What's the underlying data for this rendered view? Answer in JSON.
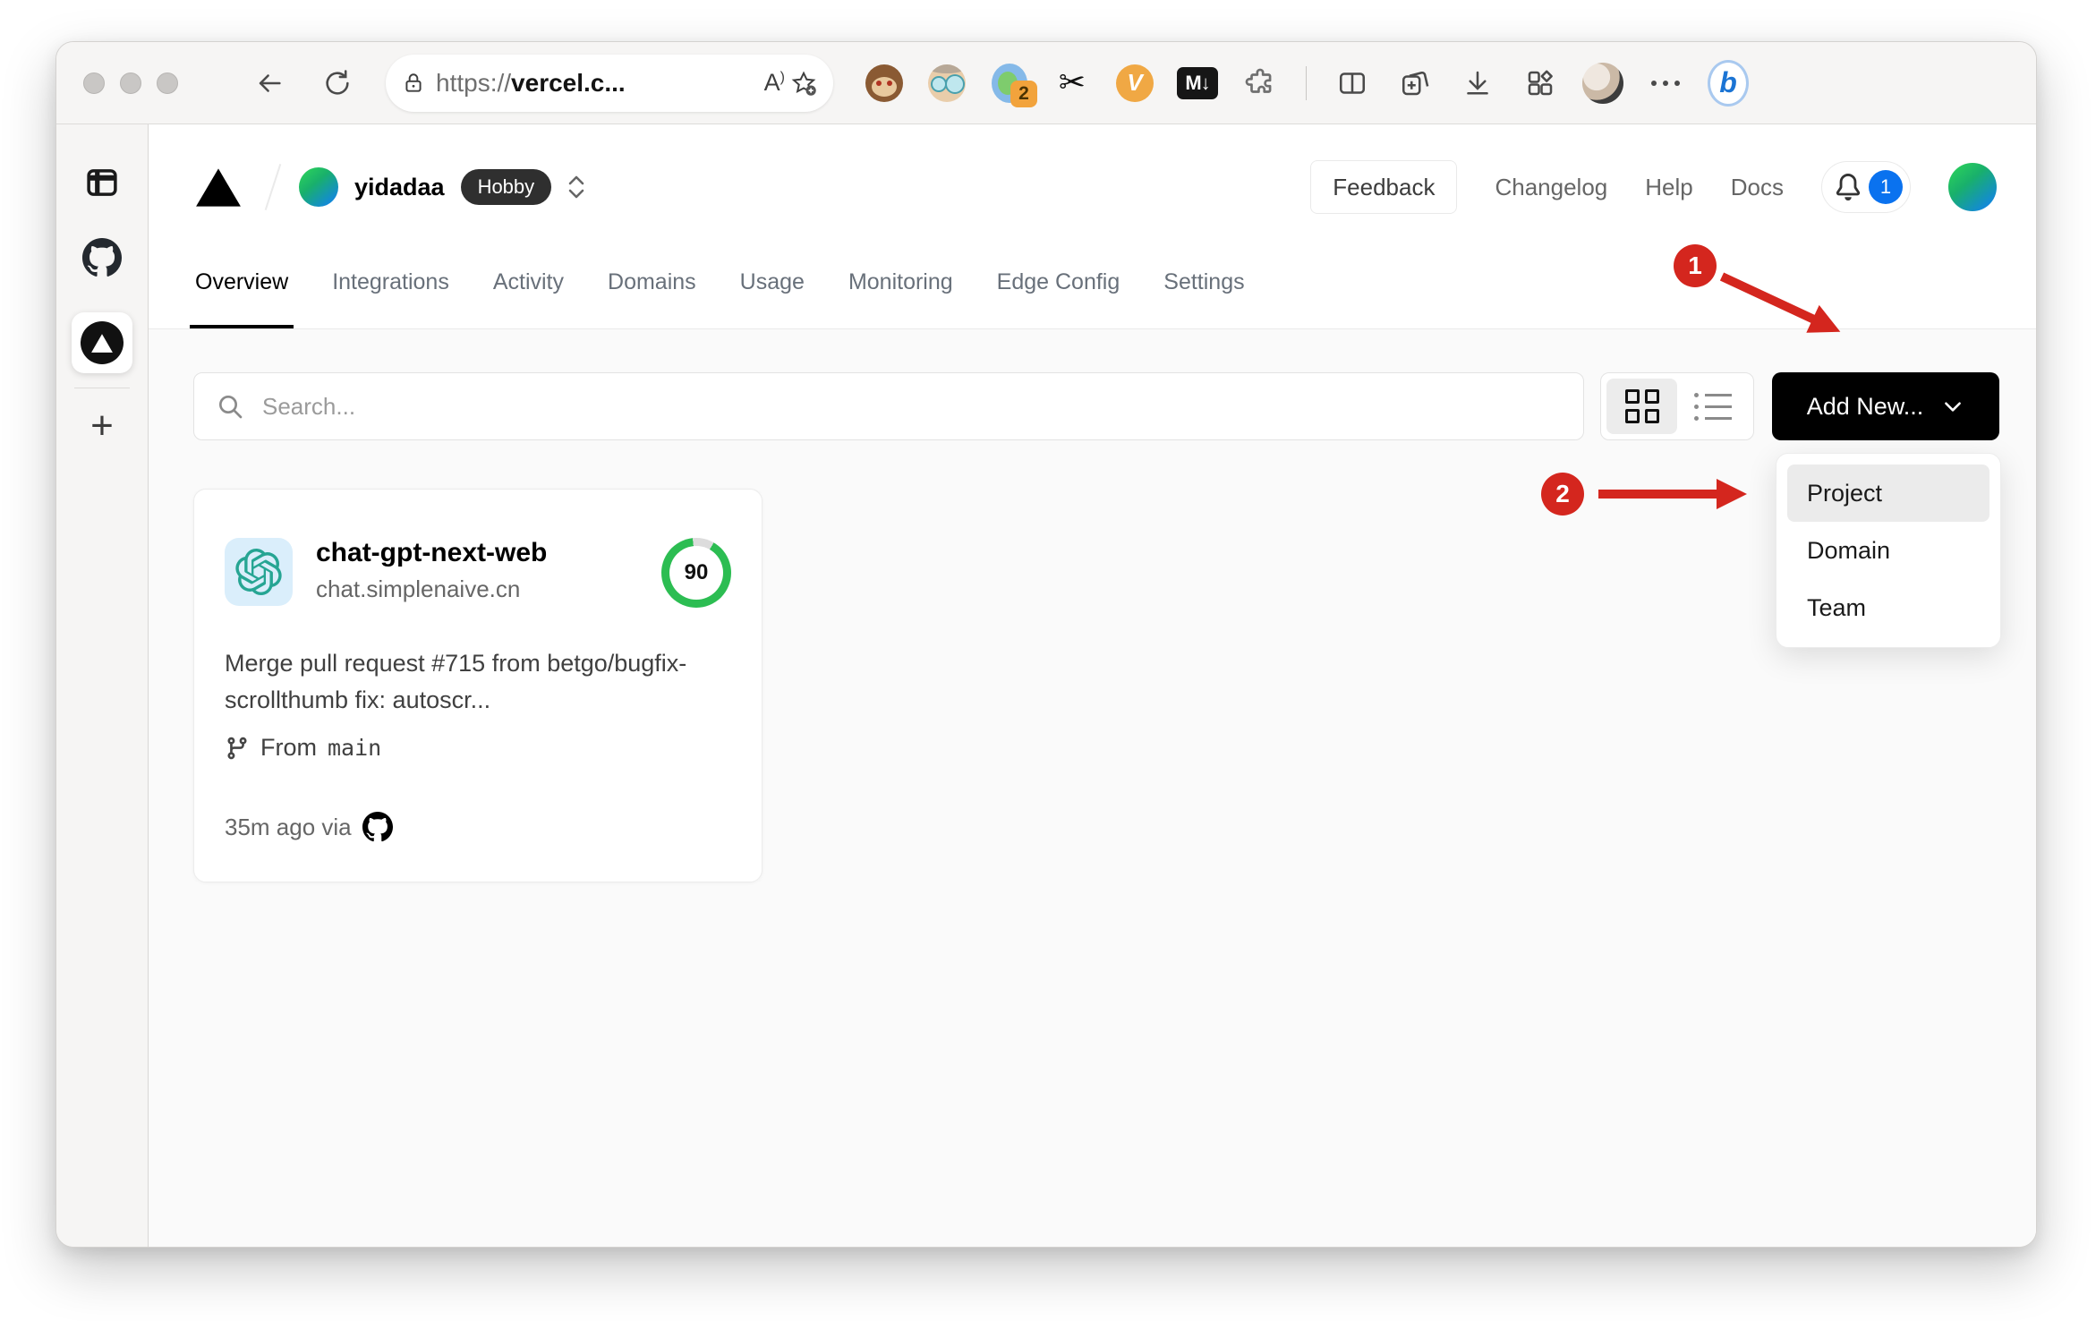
{
  "browser": {
    "url_scheme": "https://",
    "url_host": "vercel.c...",
    "read_aloud_label": "A",
    "extension_badge_count": "2",
    "ext_v_label": "V",
    "ext_markdown_label": "M↓",
    "assistant_label": "b"
  },
  "header": {
    "team_name": "yidadaa",
    "plan_badge": "Hobby",
    "feedback_label": "Feedback",
    "links": [
      {
        "label": "Changelog"
      },
      {
        "label": "Help"
      },
      {
        "label": "Docs"
      }
    ],
    "notification_count": "1"
  },
  "tabs": [
    {
      "label": "Overview",
      "active": true
    },
    {
      "label": "Integrations",
      "active": false
    },
    {
      "label": "Activity",
      "active": false
    },
    {
      "label": "Domains",
      "active": false
    },
    {
      "label": "Usage",
      "active": false
    },
    {
      "label": "Monitoring",
      "active": false
    },
    {
      "label": "Edge Config",
      "active": false
    },
    {
      "label": "Settings",
      "active": false
    }
  ],
  "toolbar": {
    "search_placeholder": "Search...",
    "add_new_label": "Add New..."
  },
  "dropdown": {
    "items": [
      {
        "label": "Project",
        "highlighted": true
      },
      {
        "label": "Domain",
        "highlighted": false
      },
      {
        "label": "Team",
        "highlighted": false
      }
    ]
  },
  "project_card": {
    "name": "chat-gpt-next-web",
    "domain": "chat.simplenaive.cn",
    "score": "90",
    "description": "Merge pull request #715 from betgo/bugfix-scrollthumb fix: autoscr...",
    "branch_prefix": "From",
    "branch_name": "main",
    "deployed_text": "35m ago via"
  },
  "annotations": {
    "step1": "1",
    "step2": "2",
    "accent_color": "#d4261e"
  },
  "colors": {
    "add_new_bg": "#000000",
    "notification_badge": "#0a72ef",
    "score_ring": "#2cbd52",
    "content_bg": "#fafafa"
  }
}
